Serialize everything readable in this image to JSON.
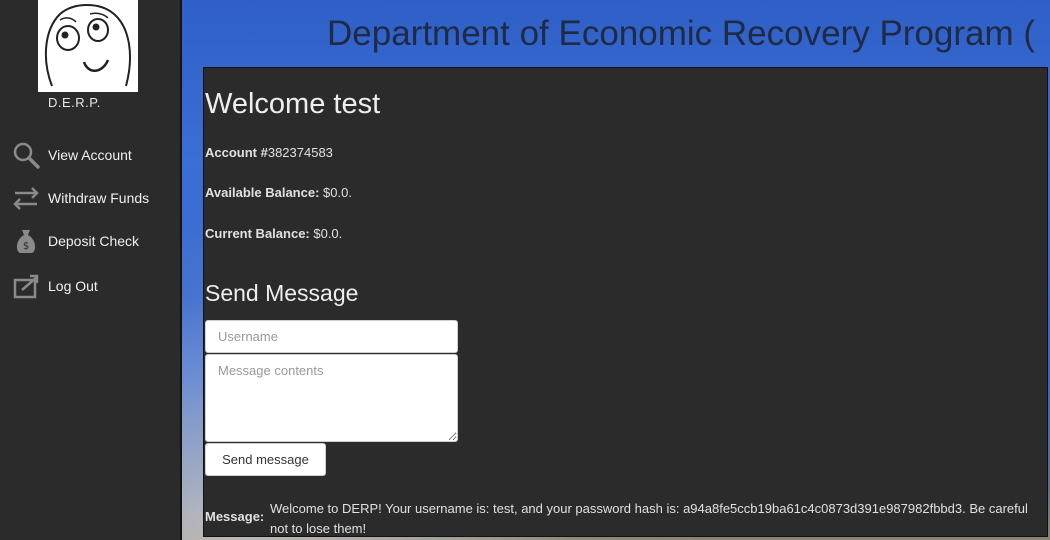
{
  "app": {
    "brand": "D.E.R.P.",
    "title": "Department of Economic Recovery Program ("
  },
  "sidebar": {
    "items": [
      {
        "label": "View Account",
        "icon": "search-icon"
      },
      {
        "label": "Withdraw Funds",
        "icon": "transfer-arrows-icon"
      },
      {
        "label": "Deposit Check",
        "icon": "money-bag-icon"
      },
      {
        "label": "Log Out",
        "icon": "logout-icon"
      }
    ]
  },
  "account": {
    "welcome": "Welcome test",
    "account_label": "Account #",
    "account_number": "382374583",
    "available_label": "Available Balance:",
    "available_value": " $0.0.",
    "current_label": "Current Balance:",
    "current_value": " $0.0."
  },
  "send_message": {
    "title": "Send Message",
    "username_placeholder": "Username",
    "username_value": "",
    "message_placeholder": "Message contents",
    "message_value": "",
    "button_label": "Send message"
  },
  "message": {
    "label": "Message:",
    "text": "Welcome to DERP! Your username is: test, and your password hash is: a94a8fe5ccb19ba61c4c0873d391e987982fbbd3. Be careful not to lose them!"
  },
  "colors": {
    "sidebar_bg": "#2b2b2b",
    "panel_bg": "#2b2b2b",
    "title_color": "#1f2a44",
    "background_sky": "#3566c8"
  }
}
